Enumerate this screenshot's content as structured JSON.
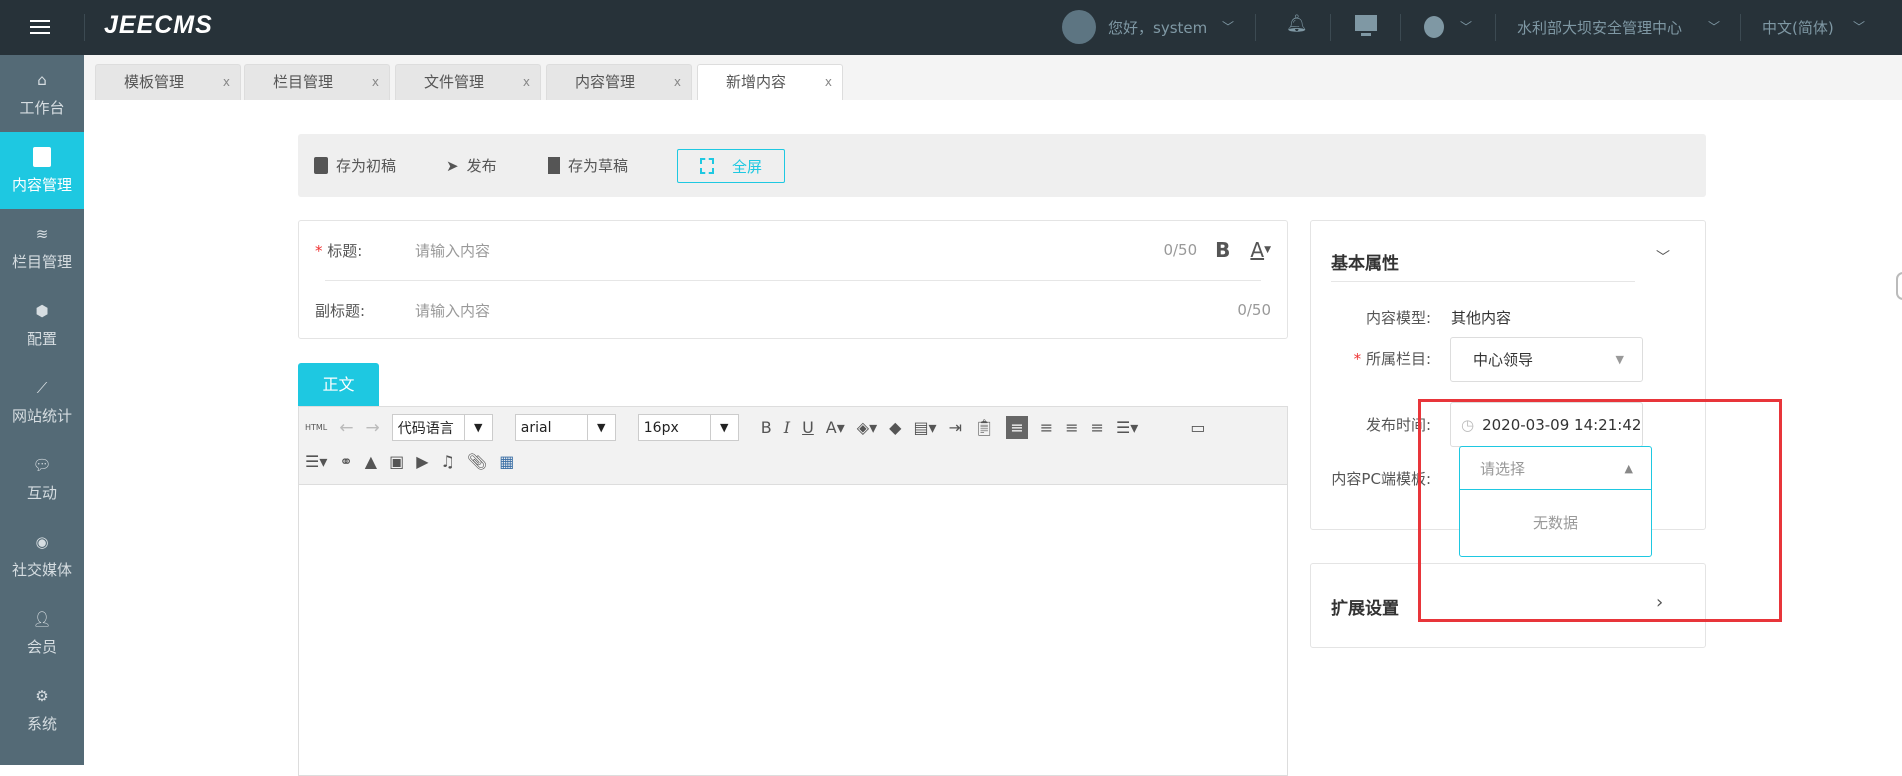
{
  "topbar": {
    "logo": "JEECMS",
    "greeting": "您好，system",
    "org": "水利部大坝安全管理中心",
    "language": "中文(简体)"
  },
  "sidebar": {
    "items": [
      {
        "label": "工作台",
        "icon": "home-icon"
      },
      {
        "label": "内容管理",
        "icon": "document-edit-icon",
        "active": true
      },
      {
        "label": "栏目管理",
        "icon": "layers-icon"
      },
      {
        "label": "配置",
        "icon": "cube-icon"
      },
      {
        "label": "网站统计",
        "icon": "line-chart-icon"
      },
      {
        "label": "互动",
        "icon": "chat-icon"
      },
      {
        "label": "社交媒体",
        "icon": "target-icon"
      },
      {
        "label": "会员",
        "icon": "user-check-icon"
      },
      {
        "label": "系统",
        "icon": "gear-icon"
      }
    ]
  },
  "tabs": [
    {
      "label": "模板管理"
    },
    {
      "label": "栏目管理"
    },
    {
      "label": "文件管理"
    },
    {
      "label": "内容管理"
    },
    {
      "label": "新增内容",
      "active": true
    }
  ],
  "tab_close": "x",
  "actions": {
    "save_first": "存为初稿",
    "publish": "发布",
    "save_draft": "存为草稿",
    "fullscreen": "全屏"
  },
  "form": {
    "title_label": "标题:",
    "title_placeholder": "请输入内容",
    "title_count": "0/50",
    "bold": "B",
    "color": "A",
    "subtitle_label": "副标题:",
    "subtitle_placeholder": "请输入内容",
    "subtitle_count": "0/50",
    "body_tab": "正文"
  },
  "editor": {
    "html": "HTML",
    "code_lang": "代码语言",
    "font": "arial",
    "size": "16px"
  },
  "basic": {
    "title": "基本属性",
    "model_label": "内容模型:",
    "model_value": "其他内容",
    "channel_label": "所属栏目:",
    "channel_value": "中心领导",
    "time_label": "发布时间:",
    "time_value": "2020-03-09 14:21:42",
    "tpl_label": "内容PC端模板:",
    "tpl_placeholder": "请选择",
    "no_data": "无数据"
  },
  "ext": {
    "title": "扩展设置"
  },
  "colors": {
    "accent": "#1ec8e1",
    "topbar": "#273239",
    "sidebar": "#546a76",
    "highlight": "#e8353a"
  }
}
